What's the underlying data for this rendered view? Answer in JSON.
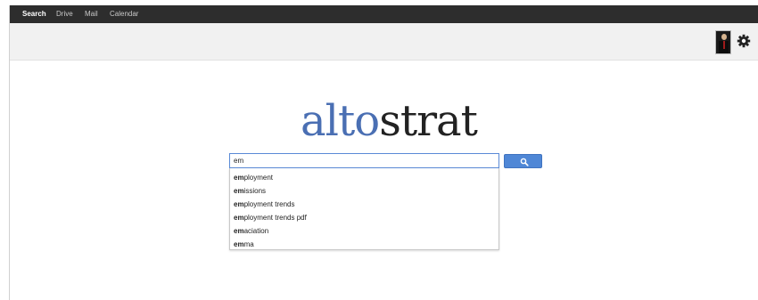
{
  "topnav": {
    "items": [
      {
        "label": "Search",
        "active": true
      },
      {
        "label": "Drive",
        "active": false
      },
      {
        "label": "Mail",
        "active": false
      },
      {
        "label": "Calendar",
        "active": false
      }
    ]
  },
  "header": {
    "avatar_icon": "user-avatar",
    "settings_icon": "gear-icon"
  },
  "logo": {
    "part1": "alto",
    "part2": "strat",
    "colors": {
      "part1": "#4a6fb3",
      "part2": "#222222"
    }
  },
  "search": {
    "value": "em",
    "button_icon": "search-icon",
    "button_color": "#4f87d6"
  },
  "suggestions": [
    {
      "prefix": "em",
      "rest": "ployment"
    },
    {
      "prefix": "em",
      "rest": "issions"
    },
    {
      "prefix": "em",
      "rest": "ployment trends"
    },
    {
      "prefix": "em",
      "rest": "ployment trends pdf"
    },
    {
      "prefix": "em",
      "rest": "aciation"
    },
    {
      "prefix": "em",
      "rest": "ma"
    }
  ]
}
